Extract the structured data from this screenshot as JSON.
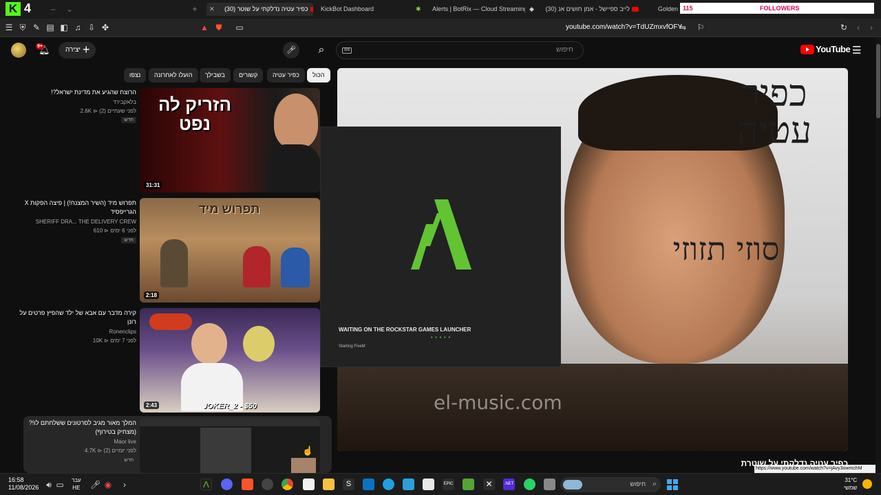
{
  "tabstrip": {
    "kick_count": "4",
    "tabs": [
      {
        "label": "(30) כפיר עטיה נדלקתי על שוטר"
      },
      {
        "label": "KickBot Dashboard"
      },
      {
        "label": "Alerts | BotRix — Cloud Streaming Bo"
      },
      {
        "label": "(30) לייב ספיישל - אמן חושים אנ"
      },
      {
        "label": "Golden"
      }
    ],
    "followers_count": "115",
    "followers_label": "FOLLOWERS"
  },
  "addressbar": {
    "url": "youtube.com/watch?v=TdUZmxvfOFY"
  },
  "header": {
    "notification_badge": "9+",
    "create_label": "יצירה",
    "search_placeholder": "חיפוש",
    "logo_text": "YouTube"
  },
  "chips": [
    "הכול",
    "כפיר עטיה",
    "קשורים",
    "בשבילך",
    "הועלו לאחרונה",
    "נצפו"
  ],
  "recommendations": [
    {
      "title": "הרוצח שהגיע את מדינת ישראל?!",
      "channel": "בלאקבירד",
      "meta": "2.6K ⊳ לפני שעתיים (2)",
      "badge": "חדש",
      "duration": "31:31",
      "thumb_text": "הזריק לה נפט"
    },
    {
      "title": "תפרוש מיד (השיר המצנח!) | פיצה הפקות X הגרייפסיד",
      "channel": "SHERIFF DRA... THE DELIVERY CREW",
      "meta": "610 ⊳ לפני 6 ימים",
      "badge": "חדש",
      "duration": "2:18",
      "thumb_text": "תפרוש מיד"
    },
    {
      "title": "קירה מדבר עם אבא של ילד שהפיץ פרטים על רונן",
      "channel": "Ronenclips",
      "meta": "10K ⊳ לפני 7 ימים",
      "badge": "",
      "duration": "2:43",
      "thumb_text": "JOKER_2 - $50"
    },
    {
      "title": "המלך מאור מגיב לסרטונים ששלחתם לו!? (מצחיק בטירוף)",
      "channel": "Maor live",
      "meta": "4.7K ⊳ לפני יומיים (2)",
      "badge": "חדש",
      "duration": "",
      "thumb_text": ""
    }
  ],
  "player": {
    "cover_top": "כפיר עטיה",
    "cover_mid": "סוזי תזוזי",
    "watermark": "el-music.com",
    "title": "כפיר עטיה נדלקתי על שוטרת"
  },
  "fivem": {
    "status": "WAITING ON THE ROCKSTAR GAMES LAUNCHER",
    "dots": "• • • • •",
    "sub": "Starting FiveM"
  },
  "status_url": "https://www.youtube.com/watch?v=jAvy3owmchM",
  "taskbar": {
    "time": "16:58",
    "date": "11/08/2026",
    "lang_top": "עבר",
    "lang_bottom": "HE",
    "search_label": "חיפוש",
    "temp": "31°C",
    "weather_text": "שמשי"
  }
}
